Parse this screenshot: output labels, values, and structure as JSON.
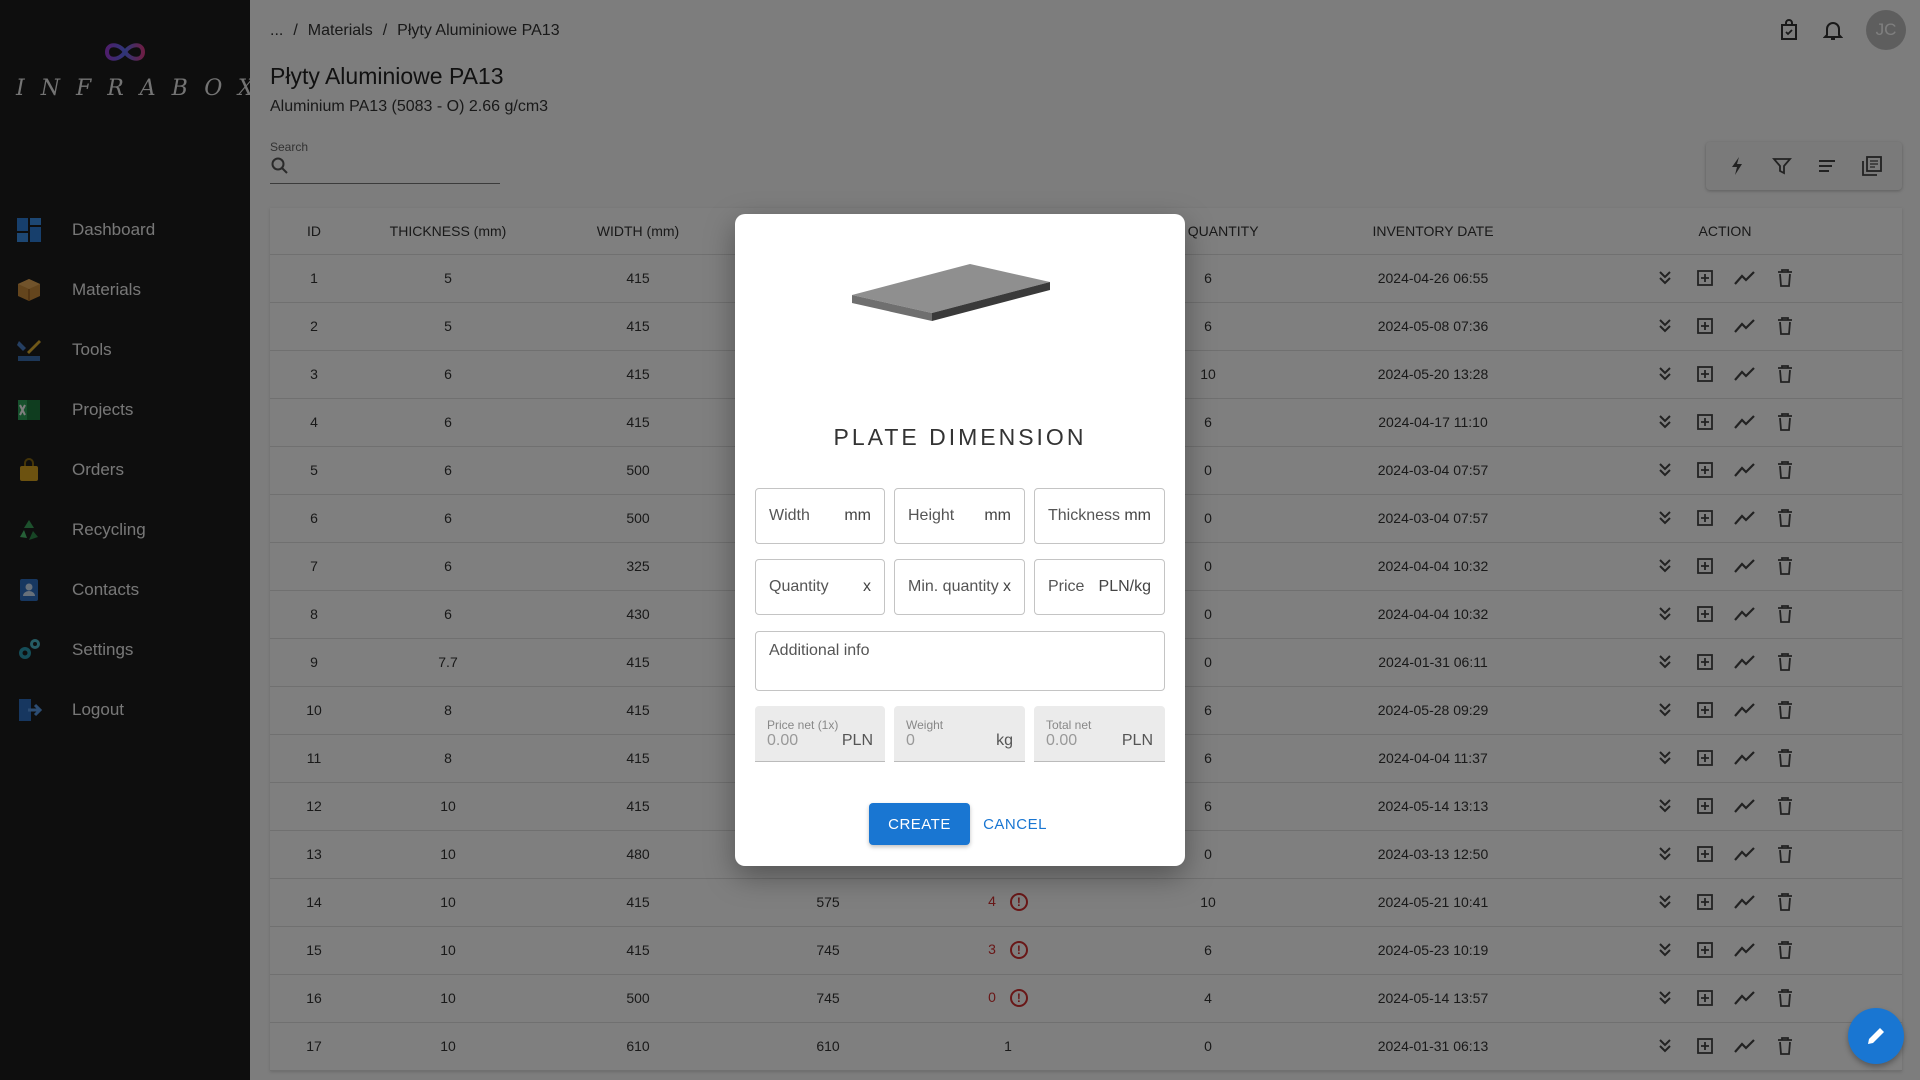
{
  "app": {
    "logo_text": "INFRABOX"
  },
  "sidebar": {
    "items": [
      {
        "label": "Dashboard",
        "icon": "dashboard-icon"
      },
      {
        "label": "Materials",
        "icon": "box-icon"
      },
      {
        "label": "Tools",
        "icon": "tools-icon"
      },
      {
        "label": "Projects",
        "icon": "spreadsheet-icon"
      },
      {
        "label": "Orders",
        "icon": "bag-icon"
      },
      {
        "label": "Recycling",
        "icon": "recycle-icon"
      },
      {
        "label": "Contacts",
        "icon": "contacts-icon"
      },
      {
        "label": "Settings",
        "icon": "gear-icon"
      },
      {
        "label": "Logout",
        "icon": "logout-icon"
      }
    ]
  },
  "header": {
    "breadcrumb": [
      "...",
      "/",
      "Materials",
      "/",
      "Płyty Aluminiowe PA13"
    ],
    "avatar_initials": "JC",
    "title": "Płyty Aluminiowe PA13",
    "subtitle": "Aluminium PA13 (5083 - O) 2.66 g/cm3"
  },
  "search": {
    "label": "Search",
    "placeholder": ""
  },
  "table": {
    "columns": [
      "ID",
      "THICKNESS (mm)",
      "WIDTH (mm)",
      "",
      "",
      "Min. QUANTITY",
      "INVENTORY DATE",
      "ACTION"
    ],
    "rows": [
      {
        "id": "1",
        "thickness": "5",
        "width": "415",
        "height": "",
        "qty": "",
        "low": false,
        "min": "6",
        "date": "2024-04-26 06:55"
      },
      {
        "id": "2",
        "thickness": "5",
        "width": "415",
        "height": "",
        "qty": "",
        "low": false,
        "min": "6",
        "date": "2024-05-08 07:36"
      },
      {
        "id": "3",
        "thickness": "6",
        "width": "415",
        "height": "",
        "qty": "",
        "low": false,
        "min": "10",
        "date": "2024-05-20 13:28"
      },
      {
        "id": "4",
        "thickness": "6",
        "width": "415",
        "height": "",
        "qty": "",
        "low": false,
        "min": "6",
        "date": "2024-04-17 11:10"
      },
      {
        "id": "5",
        "thickness": "6",
        "width": "500",
        "height": "",
        "qty": "",
        "low": false,
        "min": "0",
        "date": "2024-03-04 07:57"
      },
      {
        "id": "6",
        "thickness": "6",
        "width": "500",
        "height": "",
        "qty": "",
        "low": false,
        "min": "0",
        "date": "2024-03-04 07:57"
      },
      {
        "id": "7",
        "thickness": "6",
        "width": "325",
        "height": "",
        "qty": "",
        "low": false,
        "min": "0",
        "date": "2024-04-04 10:32"
      },
      {
        "id": "8",
        "thickness": "6",
        "width": "430",
        "height": "",
        "qty": "",
        "low": false,
        "min": "0",
        "date": "2024-04-04 10:32"
      },
      {
        "id": "9",
        "thickness": "7.7",
        "width": "415",
        "height": "",
        "qty": "",
        "low": false,
        "min": "0",
        "date": "2024-01-31 06:11"
      },
      {
        "id": "10",
        "thickness": "8",
        "width": "415",
        "height": "",
        "qty": "",
        "low": false,
        "min": "6",
        "date": "2024-05-28 09:29"
      },
      {
        "id": "11",
        "thickness": "8",
        "width": "415",
        "height": "",
        "qty": "",
        "low": false,
        "min": "6",
        "date": "2024-04-04 11:37"
      },
      {
        "id": "12",
        "thickness": "10",
        "width": "415",
        "height": "",
        "qty": "",
        "low": false,
        "min": "6",
        "date": "2024-05-14 13:13"
      },
      {
        "id": "13",
        "thickness": "10",
        "width": "480",
        "height": "",
        "qty": "",
        "low": false,
        "min": "0",
        "date": "2024-03-13 12:50"
      },
      {
        "id": "14",
        "thickness": "10",
        "width": "415",
        "height": "575",
        "qty": "4",
        "low": true,
        "min": "10",
        "date": "2024-05-21 10:41"
      },
      {
        "id": "15",
        "thickness": "10",
        "width": "415",
        "height": "745",
        "qty": "3",
        "low": true,
        "min": "6",
        "date": "2024-05-23 10:19"
      },
      {
        "id": "16",
        "thickness": "10",
        "width": "500",
        "height": "745",
        "qty": "0",
        "low": true,
        "min": "4",
        "date": "2024-05-14 13:57"
      },
      {
        "id": "17",
        "thickness": "10",
        "width": "610",
        "height": "610",
        "qty": "1",
        "low": false,
        "min": "0",
        "date": "2024-01-31 06:13"
      }
    ]
  },
  "dialog": {
    "title": "PLATE DIMENSION",
    "width_label": "Width",
    "width_unit": "mm",
    "height_label": "Height",
    "height_unit": "mm",
    "thickness_label": "Thickness",
    "thickness_unit": "mm",
    "quantity_label": "Quantity",
    "quantity_unit": "x",
    "min_quantity_label": "Min. quantity",
    "min_quantity_unit": "x",
    "price_label": "Price",
    "price_unit": "PLN/kg",
    "additional_info_label": "Additional info",
    "price_net_label": "Price net (1x)",
    "price_net_value": "0.00",
    "price_net_unit": "PLN",
    "weight_label": "Weight",
    "weight_value": "0",
    "weight_unit": "kg",
    "total_net_label": "Total net",
    "total_net_value": "0.00",
    "total_net_unit": "PLN",
    "create_label": "CREATE",
    "cancel_label": "CANCEL"
  },
  "colors": {
    "primary": "#1976d2",
    "warning": "#d32f2f",
    "sidebar_bg": "#1d1d1d"
  }
}
